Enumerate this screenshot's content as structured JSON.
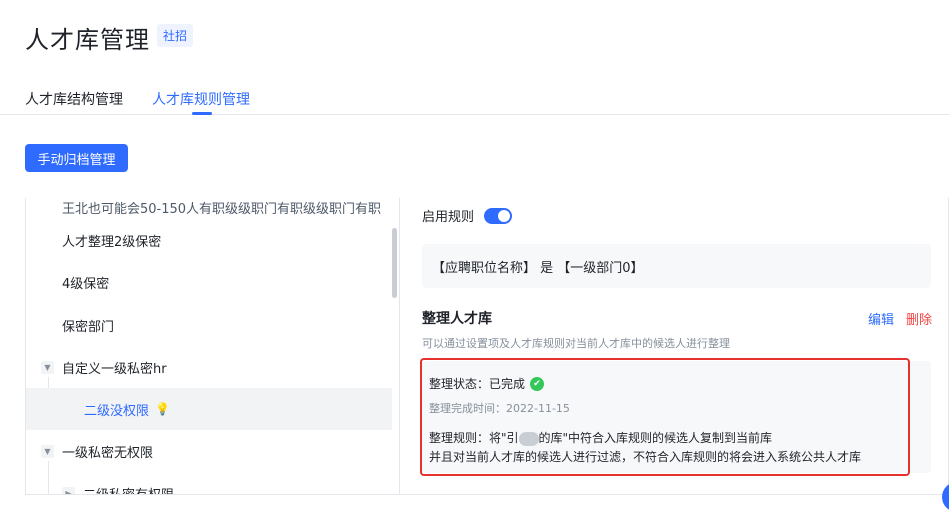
{
  "header": {
    "title": "人才库管理",
    "tag": "社招"
  },
  "tabs": [
    {
      "label": "人才库结构管理"
    },
    {
      "label": "人才库规则管理"
    }
  ],
  "toolbar": {
    "manual_archive_label": "手动归档管理"
  },
  "tree": {
    "cut_item": "王北也可能会50-150人有职级级职门有职级级职门有职",
    "items": [
      {
        "label": "人才整理2级保密"
      },
      {
        "label": "4级保密"
      },
      {
        "label": "保密部门"
      },
      {
        "label": "自定义一级私密hr"
      },
      {
        "label": "二级没权限"
      },
      {
        "label": "一级私密无权限"
      },
      {
        "label": "二级私密有权限"
      }
    ]
  },
  "rule": {
    "enable_label": "启用规则",
    "enabled": true,
    "condition": "【应聘职位名称】 是 【一级部门0】",
    "section_title": "整理人才库",
    "section_desc": "可以通过设置项及人才库规则对当前人才库中的候选人进行整理",
    "edit_label": "编辑",
    "delete_label": "删除",
    "status_label": "整理状态：已完成",
    "time_label": "整理完成时间：2022-11-15",
    "rule_part1": "整理规则：将\"引",
    "rule_part2": "的库\"中符合入库规则的候选人复制到当前库",
    "rule_line2": "并且对当前人才库的候选人进行过滤，不符合入库规则的将会进入系统公共人才库"
  },
  "colors": {
    "accent": "#2f6bff",
    "danger": "#f53f3f",
    "success": "#34c759",
    "highlight": "#e5322d"
  }
}
